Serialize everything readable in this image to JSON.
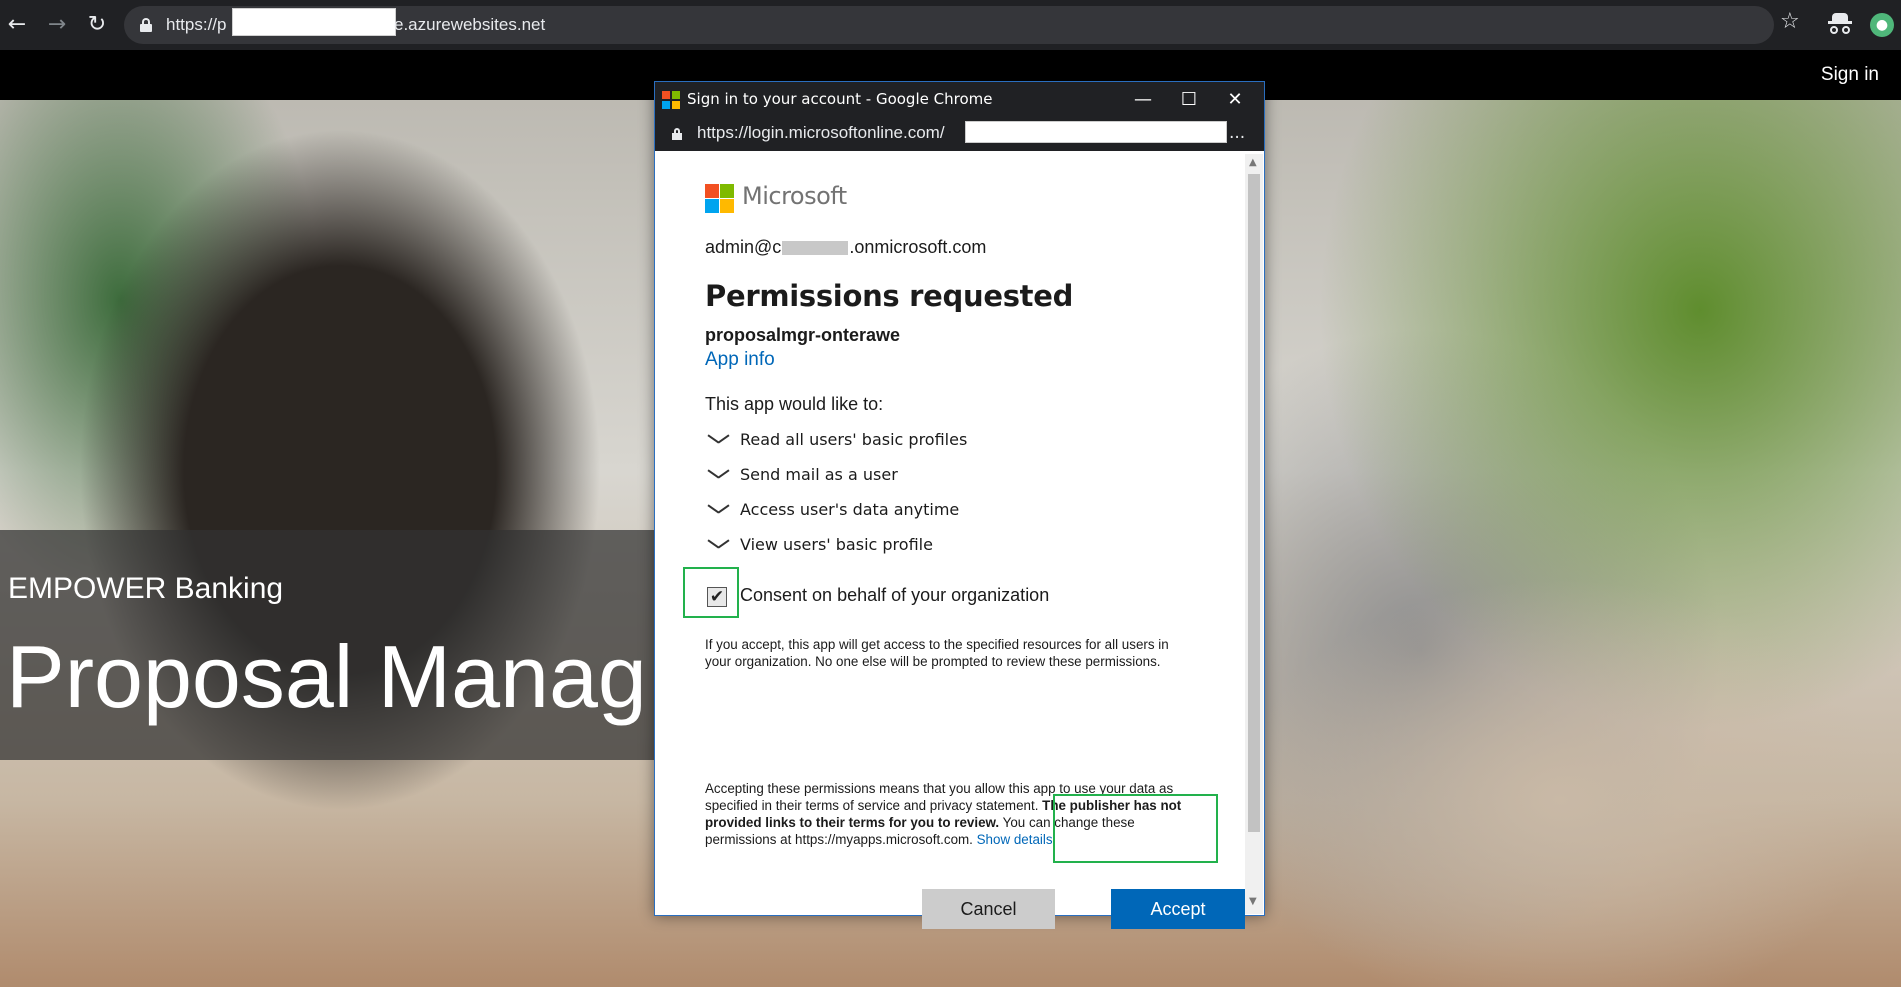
{
  "browser": {
    "url_prefix": "https://p",
    "url_suffix": "e.azurewebsites.net",
    "back_icon": "back-arrow-icon",
    "forward_icon": "forward-arrow-icon",
    "reload_icon": "reload-icon",
    "star_icon": "star-icon",
    "incognito_icon": "incognito-icon"
  },
  "site": {
    "signin_label": "Sign in",
    "hero_subtitle": "EMPOWER Banking",
    "hero_title": "Proposal Manag"
  },
  "popup": {
    "window_title": "Sign in to your account - Google Chrome",
    "url": "https://login.microsoftonline.com/",
    "url_ellipsis": "...",
    "ms_wordmark": "Microsoft",
    "account_prefix": "admin@c",
    "account_suffix": ".onmicrosoft.com",
    "heading": "Permissions requested",
    "app_name": "proposalmgr-onterawe",
    "app_info_link": "App info",
    "would_like": "This app would like to:",
    "permissions": [
      "Read all users' basic profiles",
      "Send mail as a user",
      "Access user's data anytime",
      "View users' basic profile"
    ],
    "consent_label": "Consent on behalf of your organization",
    "consent_checked": true,
    "fine_print_1": "If you accept, this app will get access to the specified resources for all users in your organization. No one else will be prompted to review these permissions.",
    "fine_print_2a": "Accepting these permissions means that you allow this app to use your data as specified in their terms of service and privacy statement. ",
    "fine_print_2b": "The publisher has not provided links to their terms for you to review.",
    "fine_print_2c": " You can change these permissions at https://myapps.microsoft.com. ",
    "show_details_link": "Show details",
    "cancel_label": "Cancel",
    "accept_label": "Accept"
  },
  "colors": {
    "accept_blue": "#0067b8",
    "link_blue": "#0067b8",
    "highlight_green": "#22b14c",
    "ms_red": "#f25022",
    "ms_green": "#7fba00",
    "ms_blue": "#00a4ef",
    "ms_yellow": "#ffb900"
  }
}
